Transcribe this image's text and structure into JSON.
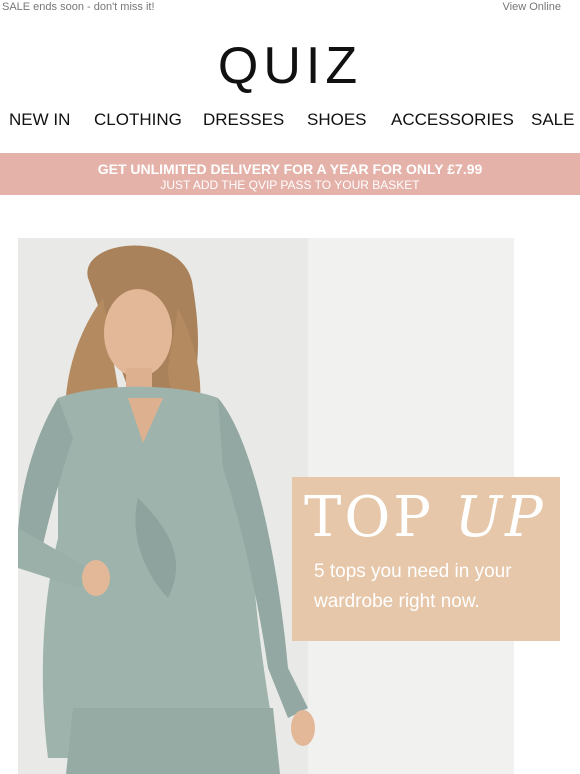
{
  "top_bar": {
    "left_text": "SALE ends soon - don't miss it!",
    "right_link": "View Online"
  },
  "brand": {
    "logo_text": "QUIZ"
  },
  "nav": {
    "items": [
      "NEW IN",
      "CLOTHING",
      "DRESSES",
      "SHOES",
      "ACCESSORIES",
      "SALE"
    ]
  },
  "promo_banner": {
    "line1": "GET UNLIMITED DELIVERY FOR A YEAR FOR ONLY £7.99",
    "line2": "JUST ADD THE QVIP PASS TO YOUR BASKET",
    "bg_color": "#e5b2aa"
  },
  "hero": {
    "headline_word1": "TOP",
    "headline_word2": "UP",
    "subtext": "5 tops you need in your wardrobe right now.",
    "overlay_color": "#e6c7aa",
    "image": "model-in-sage-wrap-top"
  }
}
